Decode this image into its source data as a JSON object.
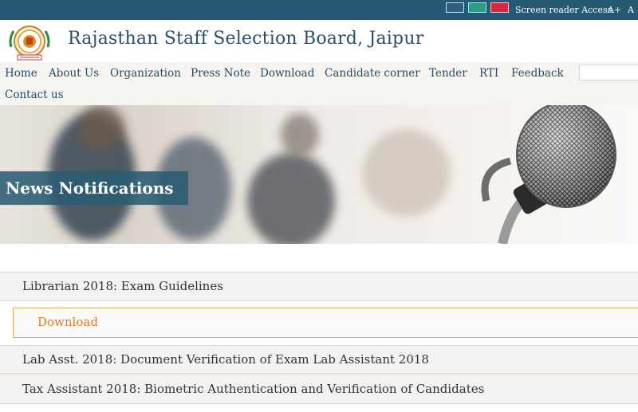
{
  "topbar": {
    "themes": [
      {
        "name": "blue-theme",
        "color": "#2f5f7a"
      },
      {
        "name": "teal-theme",
        "color": "#2e9a88"
      },
      {
        "name": "red-theme",
        "color": "#d9263a"
      }
    ],
    "screen_reader": "Screen reader Access",
    "font_increase": "A+",
    "font_normal": "A"
  },
  "header": {
    "title": "Rajasthan Staff Selection Board, Jaipur",
    "logo_icon": "rajasthan-emblem-icon"
  },
  "nav": {
    "items": [
      "Home",
      "About Us",
      "Organization",
      "Press Note",
      "Download",
      "Candidate corner",
      "Tender",
      "RTI",
      "Feedback",
      "Contact us"
    ]
  },
  "banner": {
    "title": "News Notifications",
    "image_icon": "microphone-icon"
  },
  "notices": {
    "items": [
      "Librarian 2018: Exam Guidelines",
      "Lab Asst. 2018: Document Verification of Exam Lab Assistant 2018",
      "Tax Assistant 2018: Biometric Authentication and Verification of Candidates"
    ],
    "download_label": "Download"
  },
  "colors": {
    "topbar": "#265a73",
    "title": "#2a4f69",
    "download_accent": "#e07a1f"
  }
}
